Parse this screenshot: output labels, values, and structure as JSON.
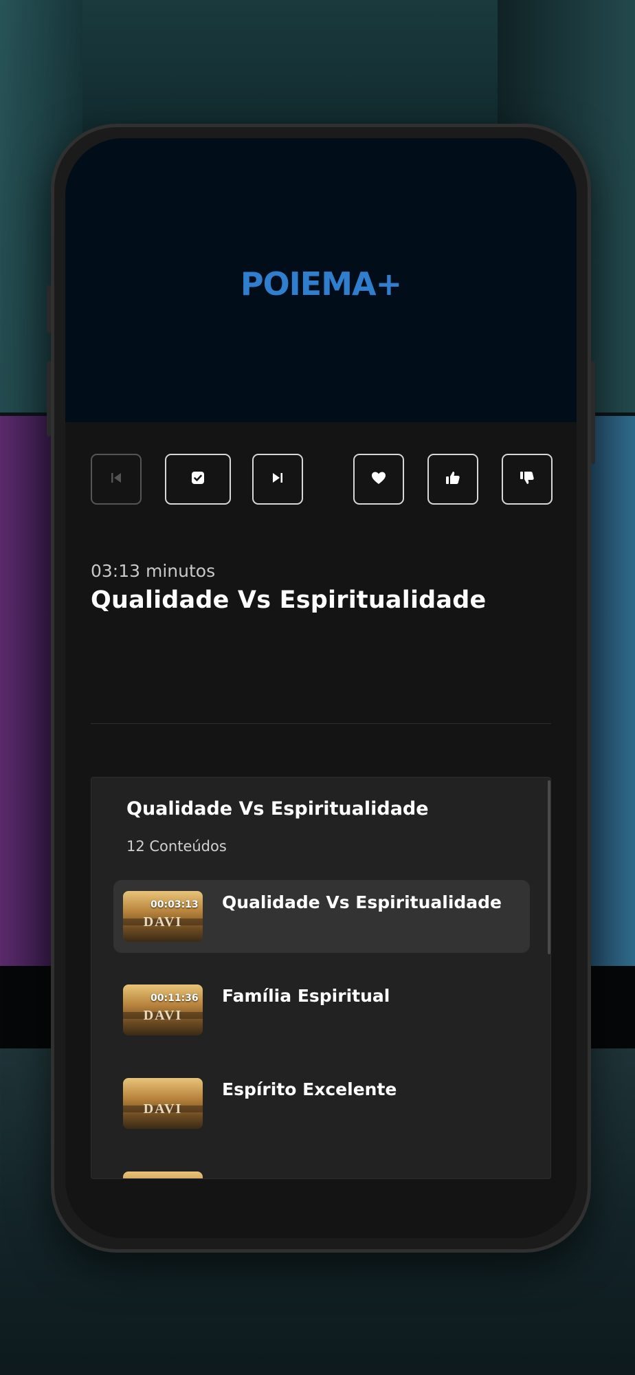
{
  "brand": {
    "logo_text": "POIEMA+",
    "accent": "#2f7fce"
  },
  "controls": [
    {
      "name": "previous-button",
      "icon": "skip-previous-icon",
      "enabled": false
    },
    {
      "name": "complete-button",
      "icon": "check-square-icon",
      "enabled": true
    },
    {
      "name": "next-button",
      "icon": "skip-next-icon",
      "enabled": true
    },
    {
      "name": "favorite-button",
      "icon": "heart-icon",
      "enabled": true
    },
    {
      "name": "like-button",
      "icon": "thumbs-up-icon",
      "enabled": true
    },
    {
      "name": "dislike-button",
      "icon": "thumbs-down-icon",
      "enabled": true
    }
  ],
  "episode": {
    "duration": "03:13 minutos",
    "title": "Qualidade Vs Espiritualidade"
  },
  "playlist": {
    "title": "Qualidade Vs Espiritualidade",
    "count": "12 Conteúdos",
    "items": [
      {
        "duration": "00:03:13",
        "title": "Qualidade Vs Espiritualidade",
        "thumb_text": "DAVI",
        "active": true
      },
      {
        "duration": "00:11:36",
        "title": "Família Espiritual",
        "thumb_text": "DAVI",
        "active": false
      },
      {
        "duration": "",
        "title": "Espírito Excelente",
        "thumb_text": "DAVI",
        "active": false
      }
    ]
  }
}
